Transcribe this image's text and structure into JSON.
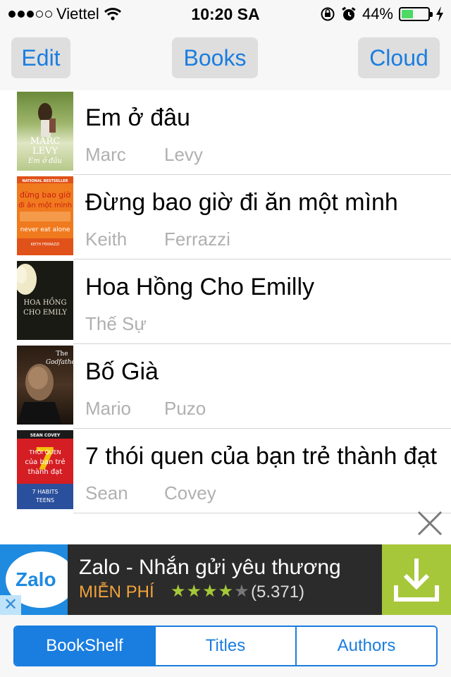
{
  "status_bar": {
    "carrier": "Viettel",
    "time": "10:20 SA",
    "battery": "44%",
    "battery_level": 0.44,
    "signal_bars": 3,
    "signal_total": 5
  },
  "nav": {
    "edit": "Edit",
    "title": "Books",
    "cloud": "Cloud"
  },
  "books": [
    {
      "title": "Em ở đâu",
      "first": "Marc",
      "last": "Levy"
    },
    {
      "title": "Đừng bao giờ đi ăn một mình",
      "first": "Keith",
      "last": "Ferrazzi"
    },
    {
      "title": "Hoa Hồng Cho Emilly",
      "first": "Thế Sự",
      "last": ""
    },
    {
      "title": "Bố Già",
      "first": "Mario",
      "last": "Puzo"
    },
    {
      "title": "7 thói quen của bạn trẻ thành đạt",
      "first": "Sean",
      "last": "Covey"
    }
  ],
  "covers": {
    "c1": {
      "line1": "MARC",
      "line2": "LEVY",
      "line3": "Em ở đâu"
    },
    "c2": {
      "top": "NATIONAL BESTSELLER",
      "line1": "đừng bao giờ",
      "line2": "đi ăn một mình",
      "line3": "never eat alone",
      "author": "KEITH FERRAZZI"
    },
    "c3": {
      "line1": "HOA HỒNG",
      "line2": "CHO EMILY"
    },
    "c4": {
      "line1": "The",
      "line2": "Godfather"
    },
    "c5": {
      "top": "SEAN COVEY",
      "num": "7",
      "line1": "THÓI QUEN",
      "line2": "của bạn trẻ",
      "line3": "thành đạt",
      "line4": "7 HABITS",
      "line5": "TEENS"
    }
  },
  "ad": {
    "logo": "Zalo",
    "title": "Zalo - Nhắn gửi yêu thương",
    "price": "MIỄN PHÍ",
    "stars_full": "★★★★",
    "stars_empty": "★",
    "rating_count": "(5.371)",
    "close_x": "✕"
  },
  "tabs": {
    "bookshelf": "BookShelf",
    "titles": "Titles",
    "authors": "Authors"
  }
}
